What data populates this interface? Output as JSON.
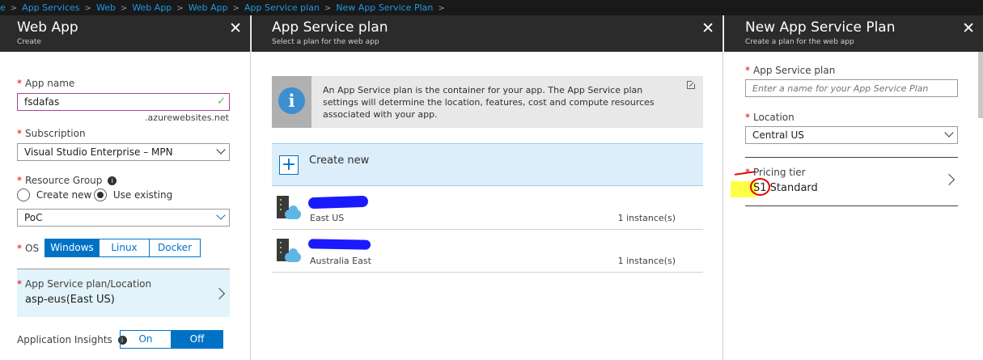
{
  "breadcrumb": [
    "e",
    "App Services",
    "Web",
    "Web App",
    "Web App",
    "App Service plan",
    "New App Service Plan"
  ],
  "blade_web_app": {
    "title": "Web App",
    "subtitle": "Create",
    "app_name_label": "App name",
    "app_name_value": "fsdafas",
    "domain_suffix": ".azurewebsites.net",
    "subscription_label": "Subscription",
    "subscription_value": "Visual Studio Enterprise – MPN",
    "resource_group_label": "Resource Group",
    "create_new_label": "Create new",
    "use_existing_label": "Use existing",
    "resource_group_value": "PoC",
    "os_label": "OS",
    "os_options": [
      "Windows",
      "Linux",
      "Docker"
    ],
    "os_selected": "Windows",
    "plan_location_label": "App Service plan/Location",
    "plan_location_value": "asp-eus(East US)",
    "app_insights_label": "Application Insights",
    "app_insights_options": [
      "On",
      "Off"
    ],
    "app_insights_selected": "Off"
  },
  "blade_plan": {
    "title": "App Service plan",
    "subtitle": "Select a plan for the web app",
    "info_text": "An App Service plan is the container for your app. The App Service plan settings will determine the location, features, cost and compute resources associated with your app.",
    "create_new_label": "Create new",
    "plans": [
      {
        "location": "East US",
        "instances": "1 instance(s)"
      },
      {
        "location": "Australia East",
        "instances": "1 instance(s)"
      }
    ]
  },
  "blade_new_plan": {
    "title": "New App Service Plan",
    "subtitle": "Create a plan for the web app",
    "plan_label": "App Service plan",
    "plan_placeholder": "Enter a name for your App Service Plan",
    "location_label": "Location",
    "location_value": "Central US",
    "pricing_tier_label": "Pricing tier",
    "pricing_tier_value": "S1 Standard"
  },
  "colors": {
    "accent": "#0072c6",
    "header_bg": "#2b2b2b",
    "breadcrumb_link": "#1e9ae3",
    "selected_row_bg": "#e2f3fb",
    "info_icon_bg": "#3d8fcf",
    "annotation_red": "#e00000",
    "highlight_yellow": "#ffff33",
    "redaction_blue": "#1a1aff"
  },
  "icons": [
    "close-icon",
    "checkmark-icon",
    "info-icon",
    "chevron-down-icon",
    "chevron-right-icon",
    "external-link-icon",
    "plus-icon",
    "server-cloud-icon"
  ]
}
